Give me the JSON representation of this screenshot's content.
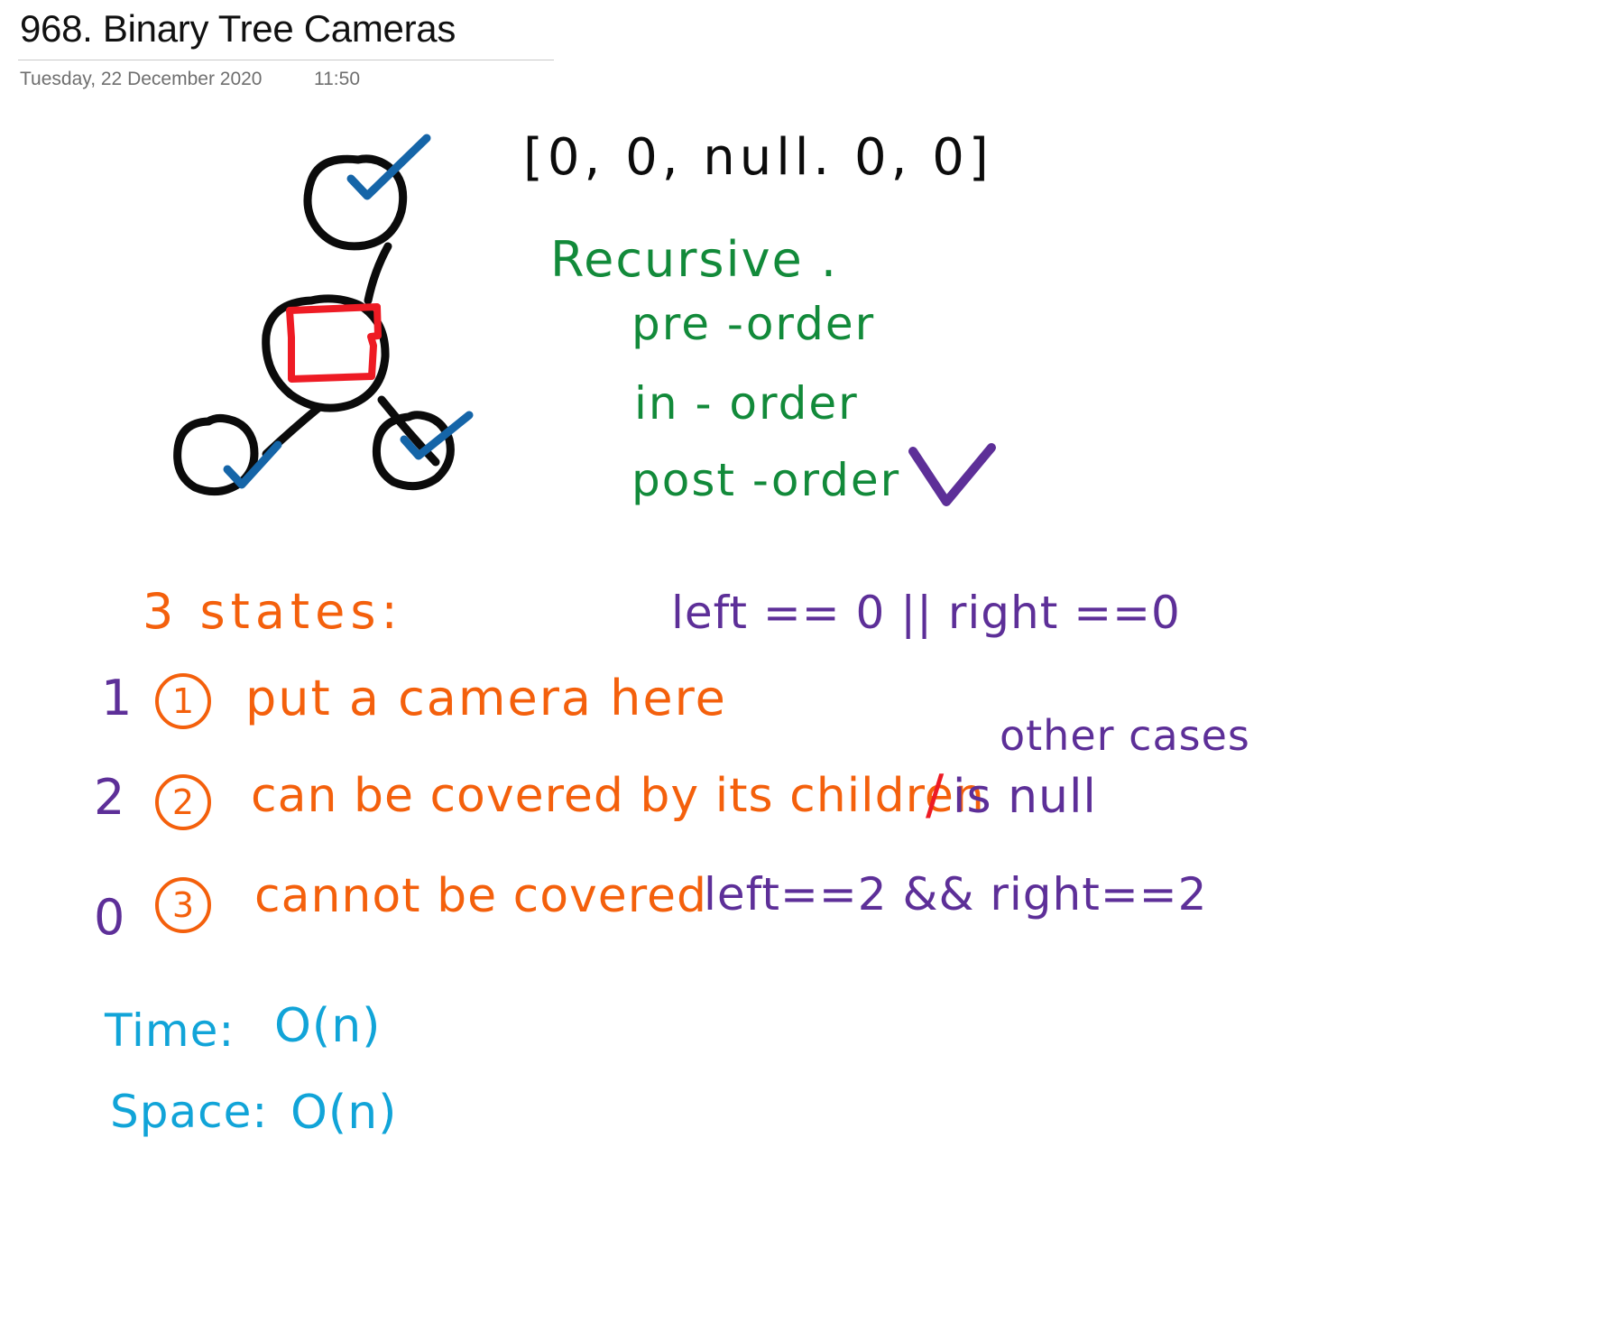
{
  "header": {
    "title": "968. Binary Tree Cameras",
    "date": "Tuesday, 22 December 2020",
    "time": "11:50"
  },
  "notes": {
    "array_input": "[0, 0, null. 0, 0]",
    "recursive_heading": "Recursive .",
    "traversals": [
      {
        "label": "pre -order",
        "checked": false
      },
      {
        "label": "in - order",
        "checked": false
      },
      {
        "label": "post -order",
        "checked": true
      }
    ],
    "states_heading": "3 states:",
    "states": [
      {
        "state_value": "1",
        "marker": "1",
        "description": "put a camera here",
        "condition": "left == 0  || right ==0"
      },
      {
        "state_value": "2",
        "marker": "2",
        "description": "can be covered by its children",
        "separator": "/",
        "condition": "is null",
        "annotation": "other cases"
      },
      {
        "state_value": "0",
        "marker": "3",
        "description": "cannot be covered",
        "condition": "left==2 && right==2"
      }
    ],
    "complexity": {
      "time_label": "Time:",
      "time_value": "O(n)",
      "space_label": "Space:",
      "space_value": "O(n)"
    }
  },
  "diagram": {
    "name": "binary-tree-sketch",
    "nodes": [
      {
        "id": "root",
        "label": "",
        "mark": "check"
      },
      {
        "id": "mid",
        "label": "camera",
        "mark": "camera-box"
      },
      {
        "id": "left-child",
        "label": "",
        "mark": "check"
      },
      {
        "id": "right-child",
        "label": "",
        "mark": "check"
      }
    ]
  },
  "colors": {
    "ink_black": "#0b0b0b",
    "ink_green": "#128a3a",
    "ink_orange": "#f4600c",
    "ink_purple": "#5d2f98",
    "ink_cyan": "#11a4d8",
    "ink_red": "#ee1b24",
    "ink_blue": "#1565a8",
    "page_bg": "#ffffff"
  }
}
